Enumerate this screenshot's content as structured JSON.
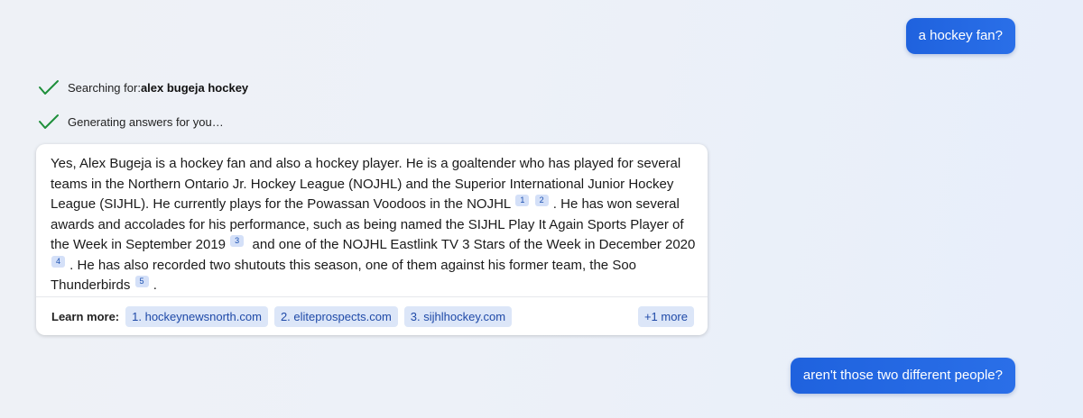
{
  "conversation": {
    "user_message_1": "a hockey fan?",
    "status": {
      "searching_prefix": "Searching for: ",
      "searching_query": "alex bugeja hockey",
      "generating": "Generating answers for you…"
    },
    "answer": {
      "part1": "Yes, Alex Bugeja is a hockey fan and also a hockey player. He is a goaltender who has played for several teams in the Northern Ontario Jr. Hockey League (NOJHL) and the Superior International Junior Hockey League (SIJHL). He currently plays for the Powassan Voodoos in the NOJHL",
      "cite1": "1",
      "cite2": "2",
      "part2": ". He has won several awards and accolades for his performance, such as being named the SIJHL Play It Again Sports Player of the Week in September 2019",
      "cite3": "3",
      "part3": " and one of the NOJHL Eastlink TV 3 Stars of the Week in December 2020",
      "cite4": "4",
      "part4": ". He has also recorded two shutouts this season, one of them against his former team, the Soo Thunderbirds",
      "cite5": "5",
      "part5": "."
    },
    "learn_more": {
      "label": "Learn more:",
      "links": [
        "1. hockeynewsnorth.com",
        "2. eliteprospects.com",
        "3. sijhlhockey.com"
      ],
      "more": "+1 more"
    },
    "user_message_2": "aren't those two different people?"
  },
  "colors": {
    "user_bubble": "#1f62de",
    "check": "#1e8f3a",
    "chip_bg": "#dce6f8",
    "chip_text": "#1f4aa8"
  },
  "icons": {
    "status": "checkmark-icon"
  }
}
